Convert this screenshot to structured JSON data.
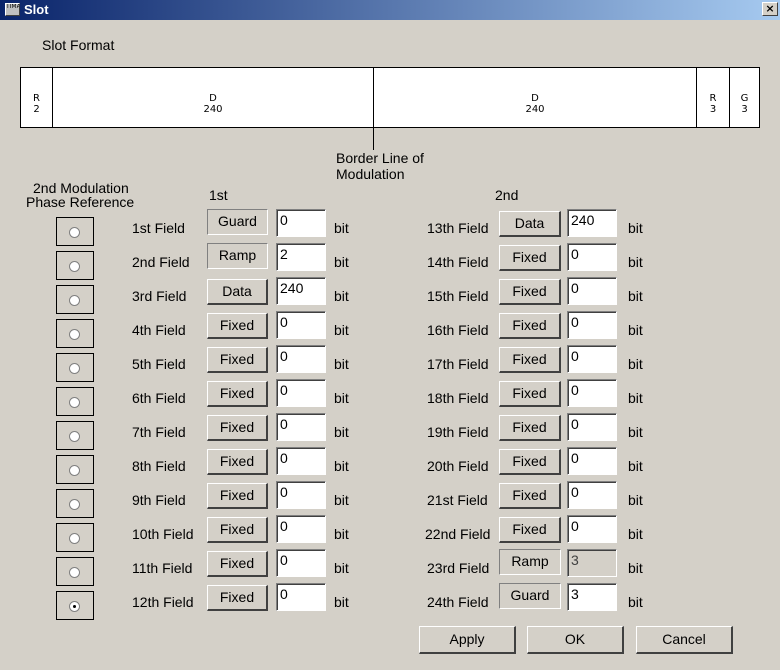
{
  "window": {
    "title": "Slot",
    "icon_text": "TIMA",
    "close_glyph": "×"
  },
  "slot_format": {
    "label": "Slot Format",
    "segments": [
      {
        "name": "R",
        "value": "2"
      },
      {
        "name": "D",
        "value": "240"
      },
      {
        "name": "D",
        "value": "240"
      },
      {
        "name": "R",
        "value": "3"
      },
      {
        "name": "G",
        "value": "3"
      }
    ],
    "border_label_1": "Border Line of",
    "border_label_2": "Modulation"
  },
  "phase_ref": {
    "label_1": "2nd Modulation",
    "label_2": "Phase Reference",
    "selected_index": 11
  },
  "headers": {
    "first": "1st",
    "second": "2nd"
  },
  "unit": "bit",
  "fields_1st": [
    {
      "label": "1st Field",
      "type": "Guard",
      "value": "0"
    },
    {
      "label": "2nd Field",
      "type": "Ramp",
      "value": "2"
    },
    {
      "label": "3rd Field",
      "type": "Data",
      "value": "240"
    },
    {
      "label": "4th Field",
      "type": "Fixed",
      "value": "0"
    },
    {
      "label": "5th Field",
      "type": "Fixed",
      "value": "0"
    },
    {
      "label": "6th Field",
      "type": "Fixed",
      "value": "0"
    },
    {
      "label": "7th Field",
      "type": "Fixed",
      "value": "0"
    },
    {
      "label": "8th Field",
      "type": "Fixed",
      "value": "0"
    },
    {
      "label": "9th Field",
      "type": "Fixed",
      "value": "0"
    },
    {
      "label": "10th Field",
      "type": "Fixed",
      "value": "0"
    },
    {
      "label": "11th Field",
      "type": "Fixed",
      "value": "0"
    },
    {
      "label": "12th Field",
      "type": "Fixed",
      "value": "0"
    }
  ],
  "fields_2nd": [
    {
      "label": "13th Field",
      "type": "Data",
      "value": "240"
    },
    {
      "label": "14th Field",
      "type": "Fixed",
      "value": "0"
    },
    {
      "label": "15th Field",
      "type": "Fixed",
      "value": "0"
    },
    {
      "label": "16th Field",
      "type": "Fixed",
      "value": "0"
    },
    {
      "label": "17th Field",
      "type": "Fixed",
      "value": "0"
    },
    {
      "label": "18th Field",
      "type": "Fixed",
      "value": "0"
    },
    {
      "label": "19th Field",
      "type": "Fixed",
      "value": "0"
    },
    {
      "label": "20th Field",
      "type": "Fixed",
      "value": "0"
    },
    {
      "label": "21st Field",
      "type": "Fixed",
      "value": "0"
    },
    {
      "label": "22nd Field",
      "type": "Fixed",
      "value": "0"
    },
    {
      "label": "23rd Field",
      "type": "Ramp",
      "value": "3"
    },
    {
      "label": "24th Field",
      "type": "Guard",
      "value": "3"
    }
  ],
  "buttons": {
    "apply": "Apply",
    "ok": "OK",
    "cancel": "Cancel"
  }
}
